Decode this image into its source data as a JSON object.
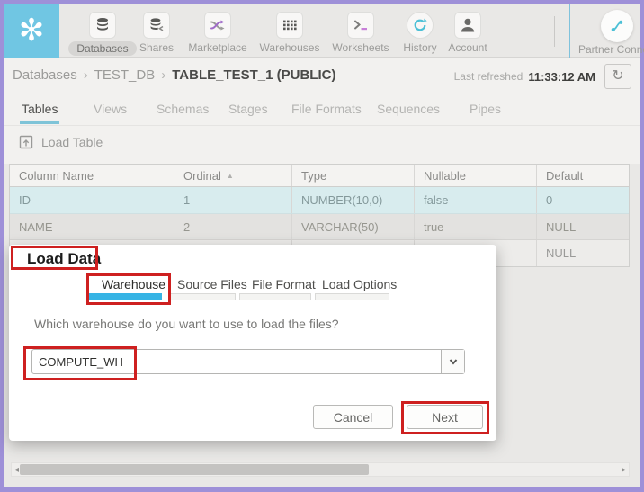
{
  "icons": {
    "snowflake": "✻",
    "breadcrumb_separator": "›",
    "sort_ascending": "▲",
    "refresh": "↻",
    "scroll_left": "◂",
    "scroll_right": "▸"
  },
  "colors": {
    "logo_blue": "#70c6e3",
    "accent_cyan": "#36b4e5",
    "active_tab_underline": "#7fc4d8",
    "row_highlight_cyan": "#d8ecee",
    "annotation_red": "#ce2020",
    "frame_purple": "#9e90d8"
  },
  "topbar": {
    "items": [
      {
        "label": "Databases",
        "icon": "database-icon",
        "active": true
      },
      {
        "label": "Shares",
        "icon": "shares-icon",
        "active": false
      },
      {
        "label": "Marketplace",
        "icon": "marketplace-icon",
        "active": false
      },
      {
        "label": "Warehouses",
        "icon": "warehouses-icon",
        "active": false
      },
      {
        "label": "Worksheets",
        "icon": "worksheets-icon",
        "active": false
      },
      {
        "label": "History",
        "icon": "history-icon",
        "active": false
      },
      {
        "label": "Account",
        "icon": "account-icon",
        "active": false
      }
    ],
    "partner_label": "Partner Conne"
  },
  "breadcrumb": {
    "items": [
      "Databases",
      "TEST_DB"
    ],
    "current": "TABLE_TEST_1 (PUBLIC)",
    "last_refreshed_label": "Last refreshed",
    "last_refreshed_time": "11:33:12 AM"
  },
  "tabs": {
    "active": "Tables",
    "items": [
      "Tables",
      "Views",
      "Schemas",
      "Stages",
      "File Formats",
      "Sequences",
      "Pipes"
    ]
  },
  "toolbar": {
    "load_table_label": "Load Table"
  },
  "table": {
    "columns": [
      "Column Name",
      "Ordinal",
      "Type",
      "Nullable",
      "Default"
    ],
    "sorted_by": "Ordinal",
    "sort_direction": "ascending",
    "rows": [
      {
        "cells": [
          "ID",
          "1",
          "NUMBER(10,0)",
          "false",
          "0"
        ]
      },
      {
        "cells": [
          "NAME",
          "2",
          "VARCHAR(50)",
          "true",
          "NULL"
        ]
      },
      {
        "cells": [
          "",
          "",
          "",
          "",
          "NULL"
        ]
      }
    ]
  },
  "modal": {
    "title": "Load Data",
    "steps": [
      {
        "label": "Warehouse",
        "active": true
      },
      {
        "label": "Source Files",
        "active": false
      },
      {
        "label": "File Format",
        "active": false
      },
      {
        "label": "Load Options",
        "active": false
      }
    ],
    "question": "Which warehouse do you want to use to load the files?",
    "warehouse_select": {
      "value": "COMPUTE_WH"
    },
    "cancel_label": "Cancel",
    "next_label": "Next"
  }
}
